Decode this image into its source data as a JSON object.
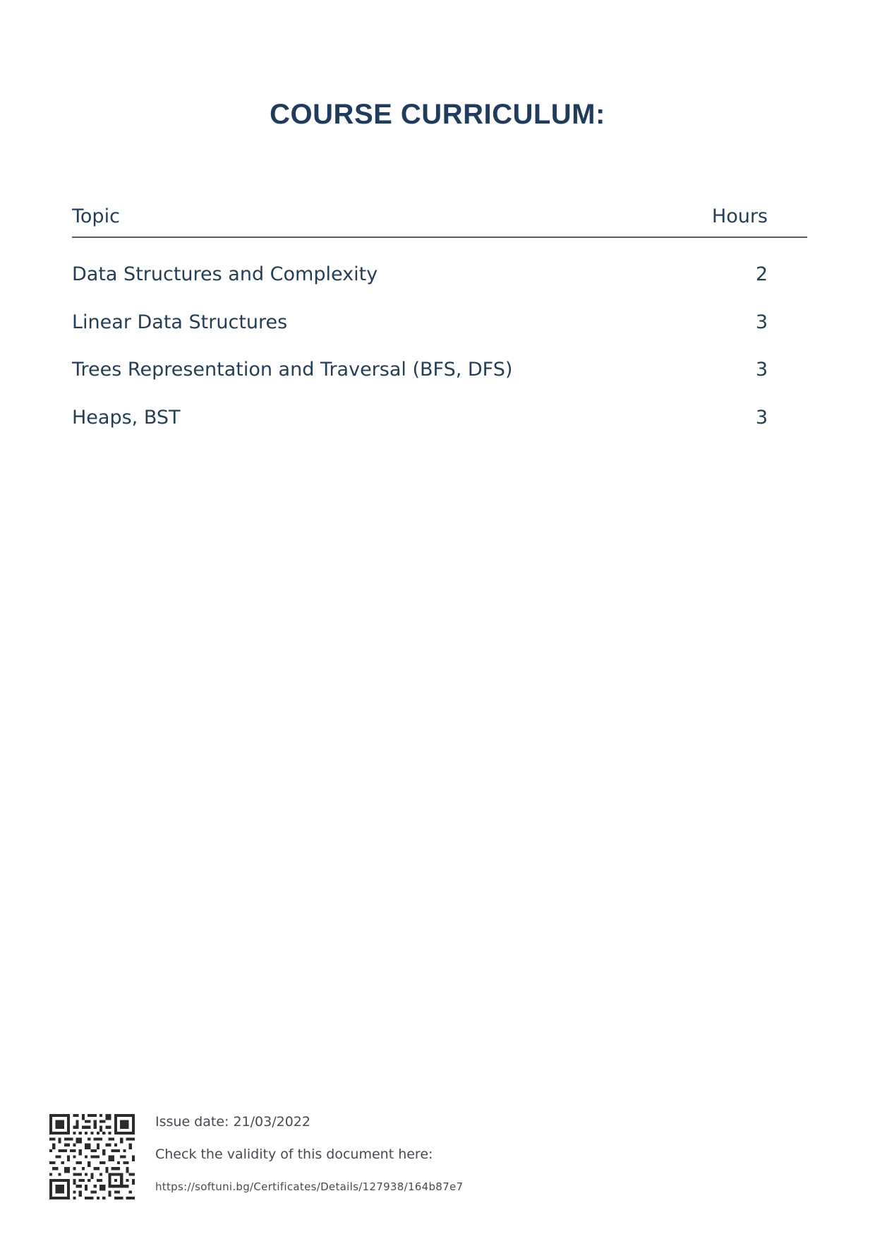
{
  "document": {
    "title": "COURSE CURRICULUM:"
  },
  "table": {
    "header": {
      "topic": "Topic",
      "hours": "Hours"
    },
    "rows": [
      {
        "topic": "Data Structures and Complexity",
        "hours": "2"
      },
      {
        "topic": "Linear Data Structures",
        "hours": "3"
      },
      {
        "topic": "Trees Representation and Traversal (BFS, DFS)",
        "hours": "3"
      },
      {
        "topic": "Heaps, BST",
        "hours": "3"
      }
    ]
  },
  "footer": {
    "issue_date": "Issue date: 21/03/2022",
    "validity_label": "Check the validity of this document here:",
    "validity_url": "https://softuni.bg/Certificates/Details/127938/164b87e7",
    "qr_icon": "qr-code-icon"
  },
  "colors": {
    "title": "#1f3c5e",
    "text": "#233d5b",
    "footer_text": "#444a52",
    "rule": "#5a5a5a"
  }
}
